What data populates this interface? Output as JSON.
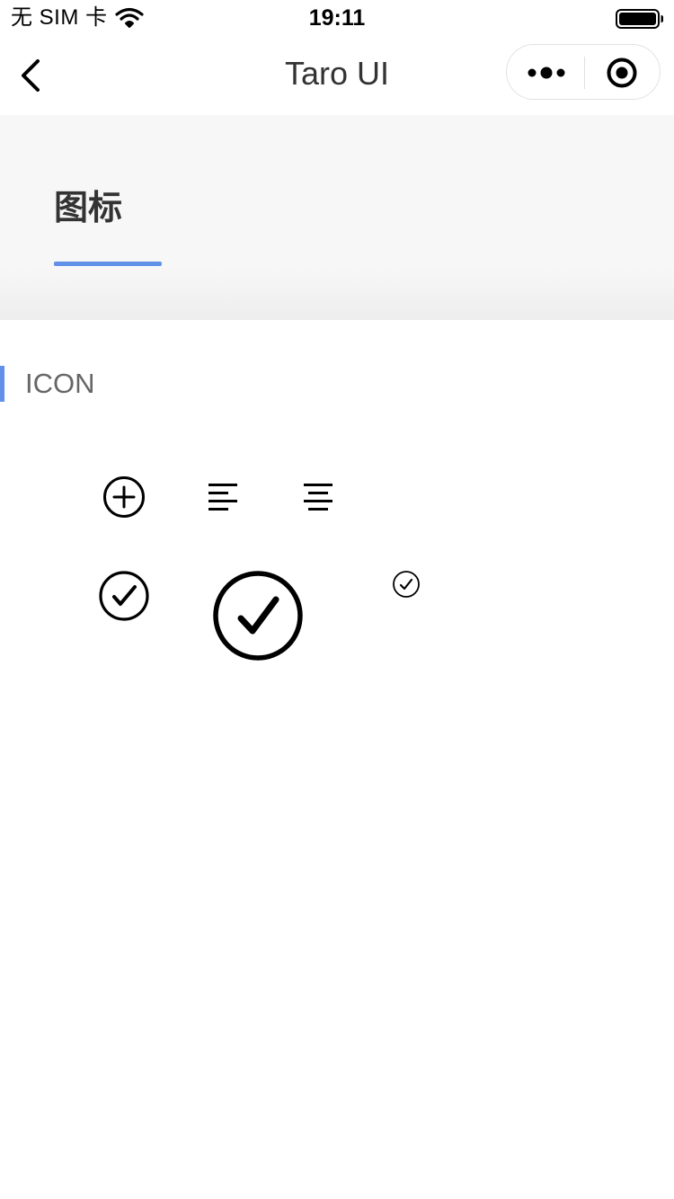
{
  "status_bar": {
    "carrier": "无 SIM 卡",
    "time": "19:11",
    "icons": [
      "wifi-icon",
      "battery-icon"
    ]
  },
  "nav_bar": {
    "title": "Taro UI",
    "icons": [
      "back-icon",
      "more-icon",
      "record-icon"
    ]
  },
  "page_header": {
    "title": "图标",
    "accent_color": "#6190e8"
  },
  "section": {
    "title": "ICON"
  },
  "icons": [
    "add-circle-icon",
    "align-left-icon",
    "align-center-icon",
    "check-circle-icon",
    "check-circle-icon-large",
    "check-circle-icon-small"
  ]
}
